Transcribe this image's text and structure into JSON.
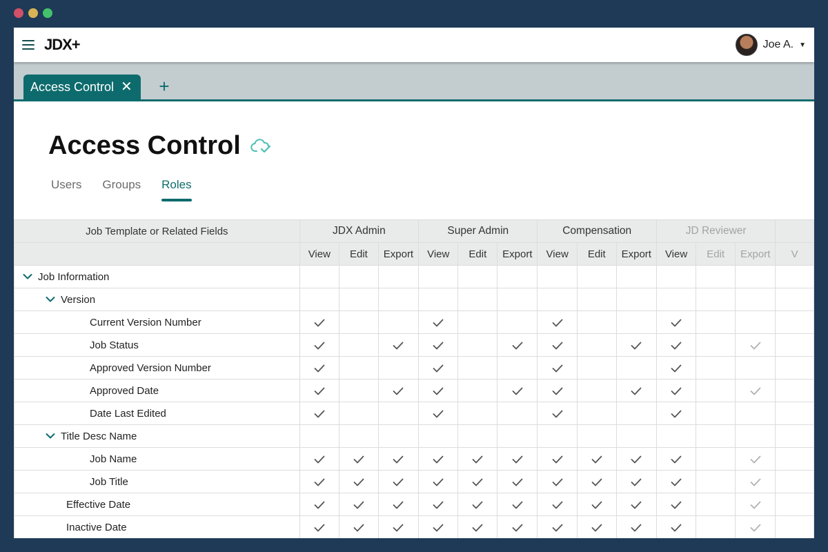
{
  "app": {
    "logo": "JDX+",
    "user_name": "Joe A."
  },
  "tabs": {
    "active": "Access Control",
    "close_icon": "close-icon",
    "add_icon": "plus-icon"
  },
  "page": {
    "title": "Access Control",
    "status_icon": "cloud-check-icon"
  },
  "subtabs": [
    {
      "label": "Users",
      "active": false
    },
    {
      "label": "Groups",
      "active": false
    },
    {
      "label": "Roles",
      "active": true
    }
  ],
  "table": {
    "field_header": "Job Template or Related Fields",
    "roles": [
      {
        "name": "JDX Admin"
      },
      {
        "name": "Super Admin"
      },
      {
        "name": "Compensation"
      },
      {
        "name": "JD Reviewer"
      }
    ],
    "permission_labels": [
      "View",
      "Edit",
      "Export"
    ],
    "partial_next_label": "V",
    "rows": [
      {
        "label": "Job Information",
        "level": 0,
        "expandable": true,
        "perms": []
      },
      {
        "label": "Version",
        "level": 1,
        "expandable": true,
        "perms": []
      },
      {
        "label": "Current Version Number",
        "level": 2,
        "perms": [
          1,
          0,
          0,
          1,
          0,
          0,
          1,
          0,
          0,
          1,
          0,
          0
        ]
      },
      {
        "label": "Job Status",
        "level": 2,
        "perms": [
          1,
          0,
          1,
          1,
          0,
          1,
          1,
          0,
          1,
          1,
          0,
          1
        ]
      },
      {
        "label": "Approved Version Number",
        "level": 2,
        "perms": [
          1,
          0,
          0,
          1,
          0,
          0,
          1,
          0,
          0,
          1,
          0,
          0
        ]
      },
      {
        "label": "Approved Date",
        "level": 2,
        "perms": [
          1,
          0,
          1,
          1,
          0,
          1,
          1,
          0,
          1,
          1,
          0,
          1
        ]
      },
      {
        "label": "Date Last Edited",
        "level": 2,
        "perms": [
          1,
          0,
          0,
          1,
          0,
          0,
          1,
          0,
          0,
          1,
          0,
          0
        ]
      },
      {
        "label": "Title Desc Name",
        "level": 1,
        "expandable": true,
        "perms": []
      },
      {
        "label": "Job Name",
        "level": 2,
        "perms": [
          1,
          1,
          1,
          1,
          1,
          1,
          1,
          1,
          1,
          1,
          0,
          1
        ]
      },
      {
        "label": "Job Title",
        "level": 2,
        "perms": [
          1,
          1,
          1,
          1,
          1,
          1,
          1,
          1,
          1,
          1,
          0,
          1
        ]
      },
      {
        "label": "Effective Date",
        "level": 1,
        "perms": [
          1,
          1,
          1,
          1,
          1,
          1,
          1,
          1,
          1,
          1,
          0,
          1
        ]
      },
      {
        "label": "Inactive Date",
        "level": 1,
        "perms": [
          1,
          1,
          1,
          1,
          1,
          1,
          1,
          1,
          1,
          1,
          0,
          1
        ]
      }
    ]
  },
  "colors": {
    "accent": "#0e6b6d",
    "background": "#1e3a56",
    "tabbar": "#c3cdd0"
  }
}
